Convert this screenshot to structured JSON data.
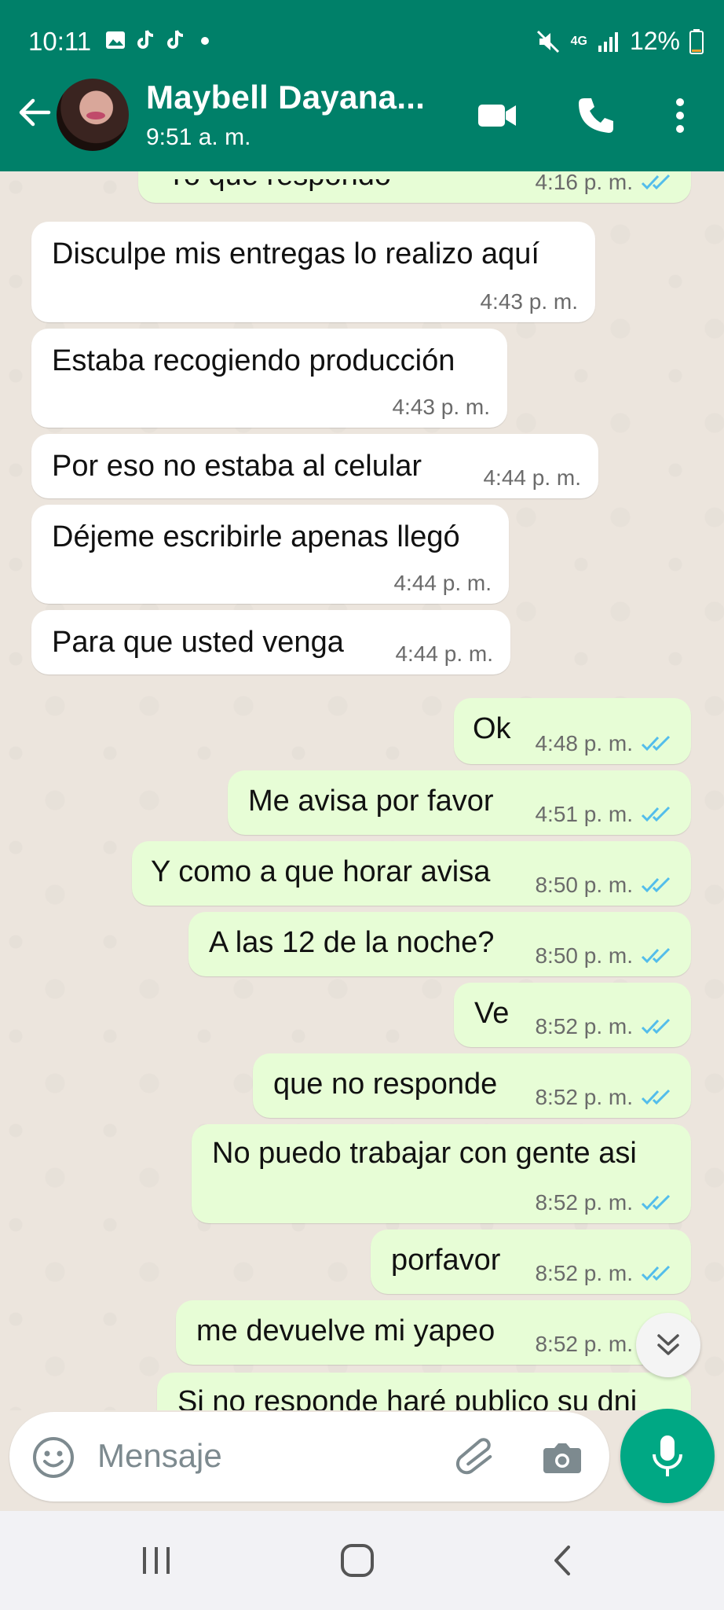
{
  "status_bar": {
    "time": "10:11",
    "battery": "12%",
    "network": "4G",
    "icons": [
      "gallery-icon",
      "tiktok-icon",
      "tiktok-icon",
      "dot-icon",
      "mute-icon",
      "signal-icon",
      "battery-icon"
    ]
  },
  "header": {
    "contact_name": "Maybell Dayana...",
    "contact_status": "9:51 a. m.",
    "icons": [
      "back-arrow-icon",
      "video-call-icon",
      "phone-icon",
      "more-vert-icon"
    ]
  },
  "messages": [
    {
      "dir": "out",
      "text": "Yo que respondo",
      "time": "4:16 p. m.",
      "ticks": "read",
      "partial": true
    },
    {
      "dir": "in",
      "text": "Disculpe mis entregas lo realizo aquí",
      "time": "4:43 p. m."
    },
    {
      "dir": "in",
      "text": "Estaba recogiendo producción",
      "time": "4:43 p. m."
    },
    {
      "dir": "in",
      "text": "Por eso no estaba al celular",
      "time": "4:44 p. m."
    },
    {
      "dir": "in",
      "text": "Déjeme escribirle apenas llegó",
      "time": "4:44 p. m."
    },
    {
      "dir": "in",
      "text": "Para que usted venga",
      "time": "4:44 p. m."
    },
    {
      "dir": "out",
      "text": "Ok",
      "time": "4:48 p. m.",
      "ticks": "read"
    },
    {
      "dir": "out",
      "text": "Me avisa por favor",
      "time": "4:51 p. m.",
      "ticks": "read"
    },
    {
      "dir": "out",
      "text": "Y como a que horar avisa",
      "time": "8:50 p. m.",
      "ticks": "read"
    },
    {
      "dir": "out",
      "text": "A las 12 de la noche?",
      "time": "8:50 p. m.",
      "ticks": "read"
    },
    {
      "dir": "out",
      "text": "Ve",
      "time": "8:52 p. m.",
      "ticks": "read"
    },
    {
      "dir": "out",
      "text": "que no responde",
      "time": "8:52 p. m.",
      "ticks": "read"
    },
    {
      "dir": "out",
      "text": "No puedo trabajar con gente asi",
      "time": "8:52 p. m.",
      "ticks": "read"
    },
    {
      "dir": "out",
      "text": "porfavor",
      "time": "8:52 p. m.",
      "ticks": "read"
    },
    {
      "dir": "out",
      "text": "me devuelve mi yapeo",
      "time": "8:52 p. m.",
      "ticks": "read"
    },
    {
      "dir": "out",
      "text": "Si no responde haré publico su dni",
      "time": "",
      "partial": true
    }
  ],
  "input": {
    "placeholder": "Mensaje"
  },
  "colors": {
    "header": "#008069",
    "outgoing_bubble": "#e7fdd6",
    "incoming_bubble": "#ffffff",
    "chat_bg": "#ece5dd",
    "read_ticks": "#53bdeb",
    "mic_button": "#00a884"
  }
}
